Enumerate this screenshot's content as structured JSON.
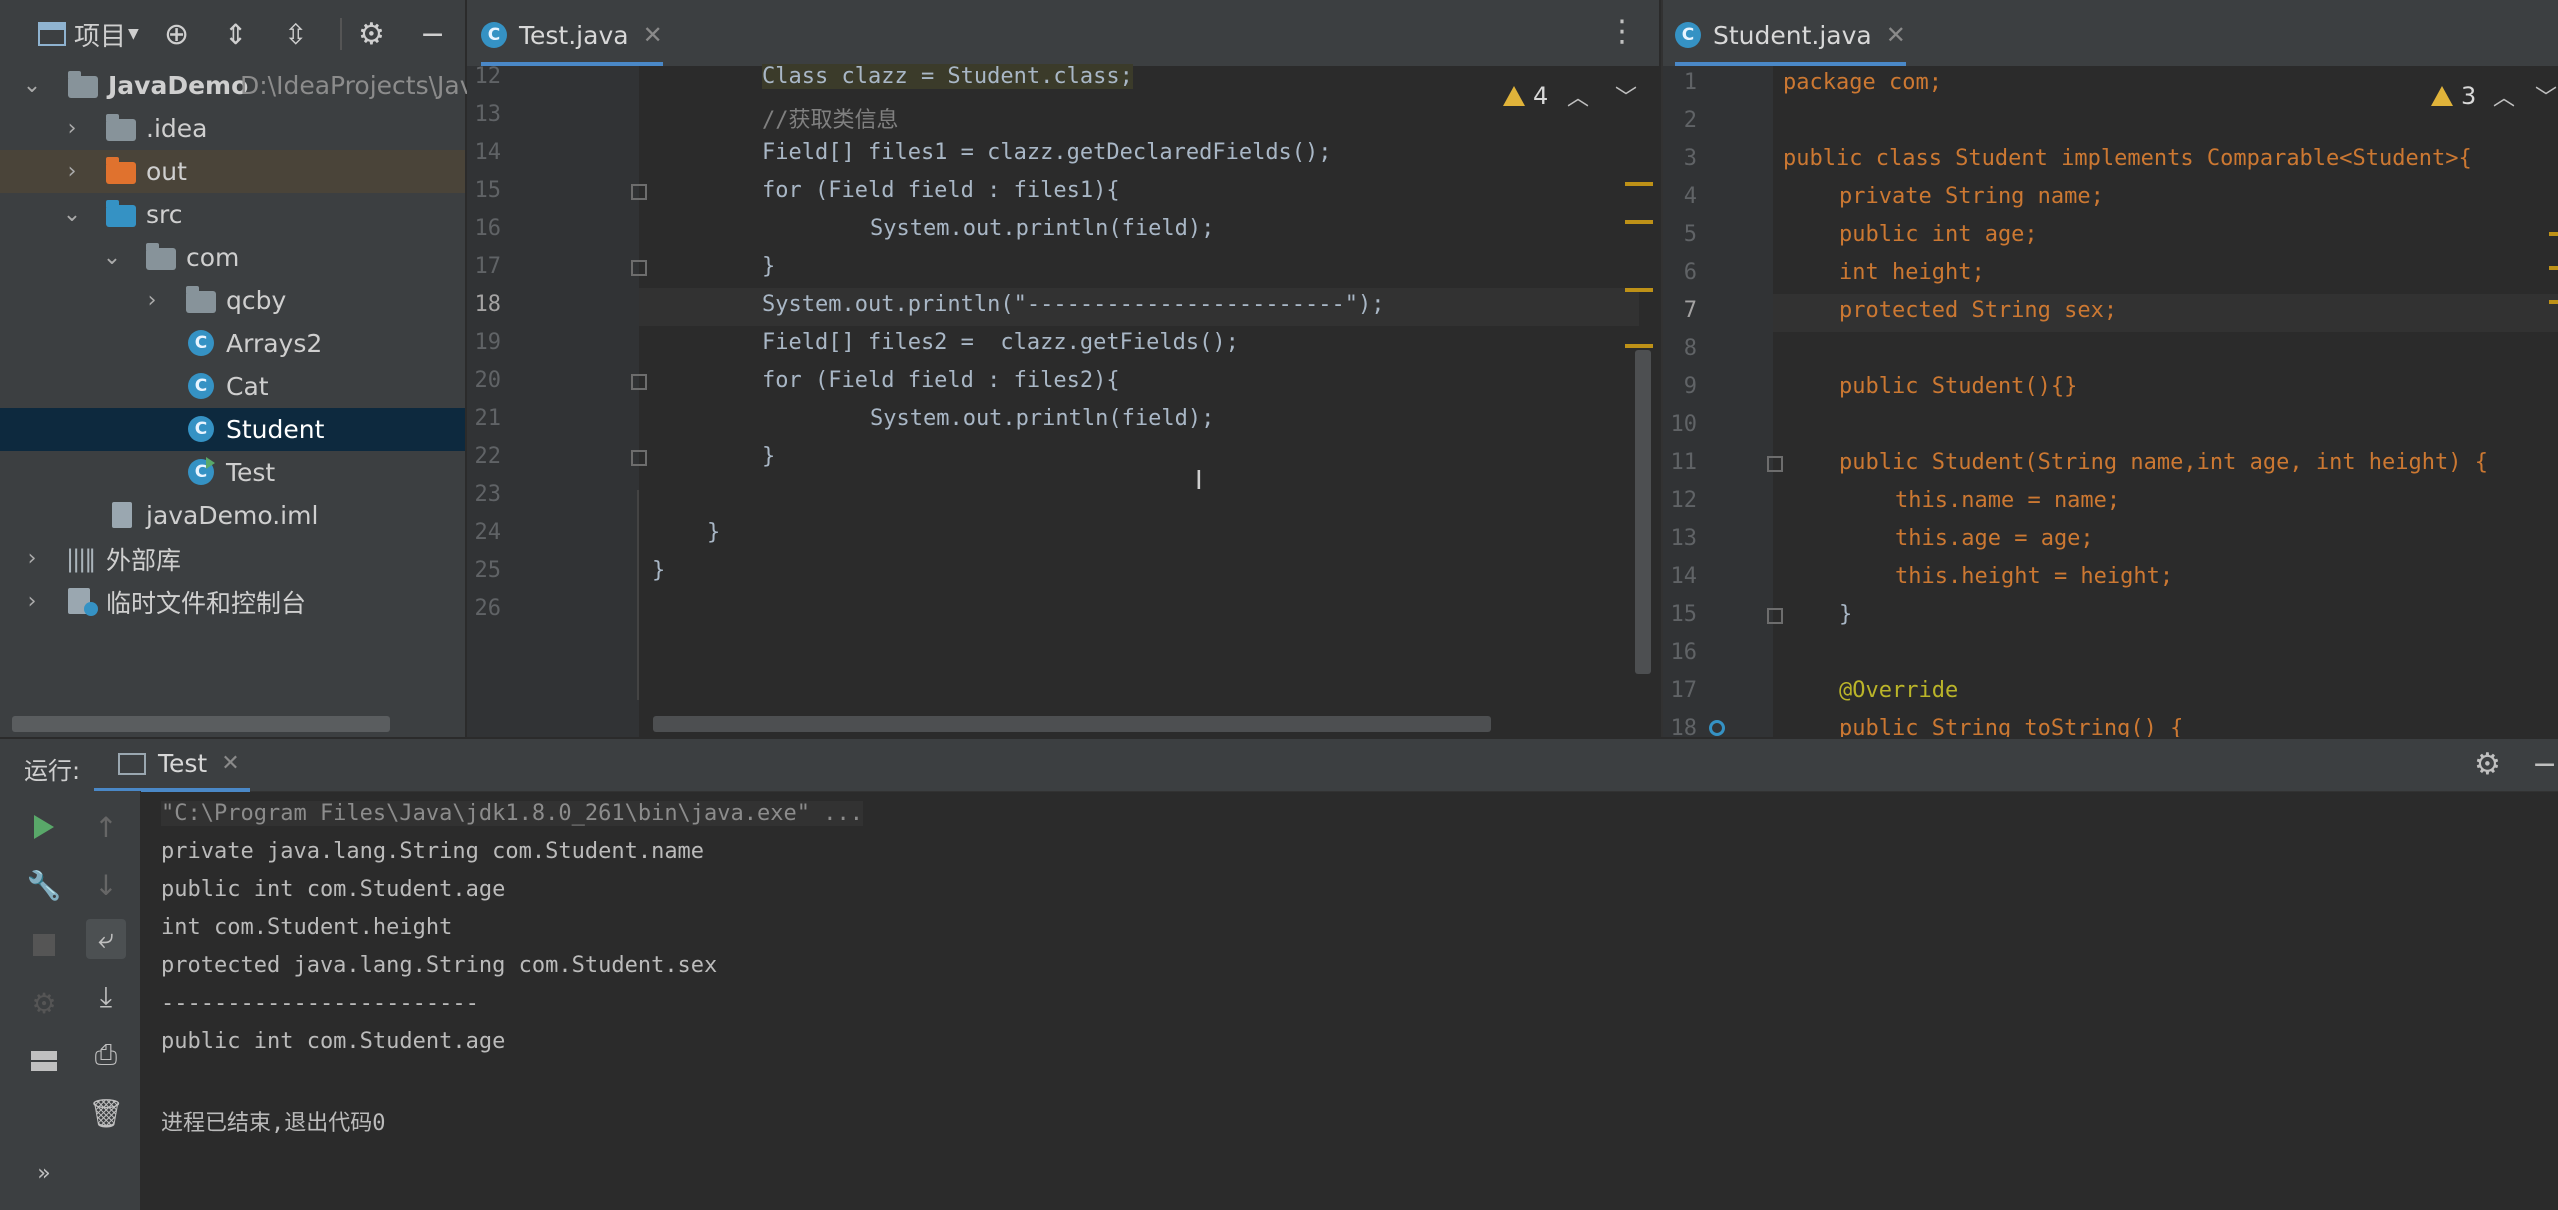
{
  "project_panel": {
    "toolbar_label": "项目",
    "tree": [
      {
        "label": "JavaDemo",
        "path": "D:\\IdeaProjects\\Java"
      },
      {
        "label": ".idea"
      },
      {
        "label": "out"
      },
      {
        "label": "src"
      },
      {
        "label": "com"
      },
      {
        "label": "qcby"
      },
      {
        "label": "Arrays2"
      },
      {
        "label": "Cat"
      },
      {
        "label": "Student"
      },
      {
        "label": "Test"
      },
      {
        "label": "javaDemo.iml"
      },
      {
        "label": "外部库"
      },
      {
        "label": "临时文件和控制台"
      }
    ]
  },
  "editor_left": {
    "tab": "Test.java",
    "warning_count": "4",
    "line_numbers": [
      "12",
      "13",
      "14",
      "15",
      "16",
      "17",
      "18",
      "19",
      "20",
      "21",
      "22",
      "23",
      "24",
      "25",
      "26"
    ],
    "current_line": "18"
  },
  "editor_right": {
    "tab": "Student.java",
    "warning_count": "3",
    "line_numbers": [
      "1",
      "2",
      "3",
      "4",
      "5",
      "6",
      "7",
      "8",
      "9",
      "10",
      "11",
      "12",
      "13",
      "14",
      "15",
      "16",
      "17",
      "18"
    ],
    "current_line": "7"
  },
  "run_panel": {
    "label": "运行:",
    "tab": "Test",
    "output": [
      "\"C:\\Program Files\\Java\\jdk1.8.0_261\\bin\\java.exe\" ...",
      "private java.lang.String com.Student.name",
      "public int com.Student.age",
      "int com.Student.height",
      "protected java.lang.String com.Student.sex",
      "------------------------",
      "public int com.Student.age",
      "",
      "进程已结束,退出代码0"
    ]
  },
  "code_left": [
    "Class clazz = Student.class;",
    "//获取类信息",
    "Field[] files1 = clazz.getDeclaredFields();",
    "for (Field field : files1){",
    "    System.out.println(field);",
    "}",
    "System.out.println(\"------------------------\");",
    "Field[] files2 =  clazz.getFields();",
    "for (Field field : files2){",
    "    System.out.println(field);",
    "}",
    "}",
    "}"
  ],
  "code_right": [
    "package com;",
    "public class Student implements Comparable<Student>{",
    "private String name;",
    "public int age;",
    "int height;",
    "protected String sex;",
    "public Student(){}",
    "public Student(String name,int age, int height) {",
    "this.name = name;",
    "this.age = age;",
    "this.height = height;",
    "}",
    "@Override",
    "public String toString() {"
  ],
  "colors": {
    "keyword": "#cc7832",
    "field": "#9876aa",
    "string": "#6a8759",
    "comment": "#808080",
    "annotation": "#bbb529",
    "selection": "#0d293e",
    "tab_underline": "#4a88c7"
  }
}
